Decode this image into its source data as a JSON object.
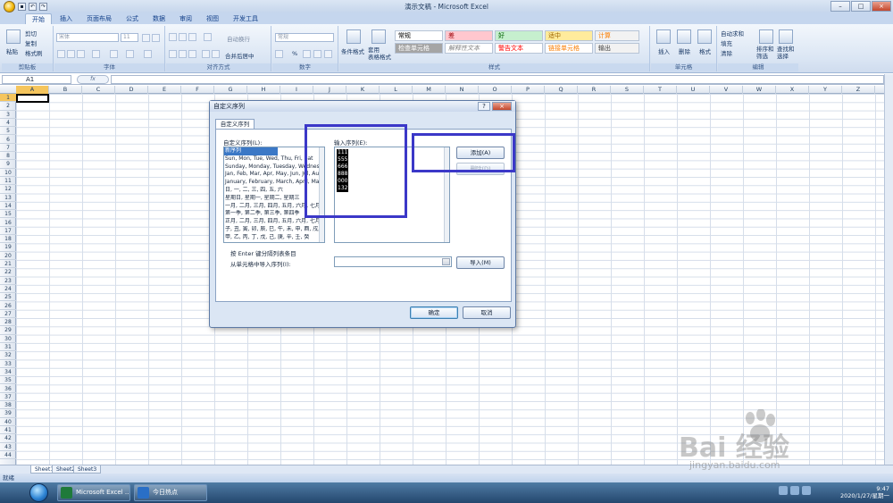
{
  "window": {
    "title": "演示文稿 - Microsoft Excel",
    "controls": [
      "–",
      "□",
      "×"
    ]
  },
  "tabs": [
    "开始",
    "插入",
    "页面布局",
    "公式",
    "数据",
    "审阅",
    "视图",
    "开发工具"
  ],
  "ribbon": {
    "clipboard": {
      "label": "剪贴板",
      "paste": "粘贴",
      "cut": "剪切",
      "copy": "复制",
      "format_painter": "格式刷"
    },
    "font": {
      "label": "字体",
      "font_name": "宋体",
      "font_size": "11"
    },
    "alignment": {
      "label": "对齐方式",
      "wrap": "自动换行",
      "merge": "合并后居中"
    },
    "number": {
      "label": "数字",
      "format": "常规",
      "percent": "%"
    },
    "styles": {
      "label": "样式",
      "conditional": "条件格式",
      "table_format": "套用\n表格格式",
      "cells": [
        {
          "text": "常规",
          "bg": "#ffffff",
          "fg": "#000000"
        },
        {
          "text": "差",
          "bg": "#ffc7ce",
          "fg": "#9c0006"
        },
        {
          "text": "好",
          "bg": "#c6efce",
          "fg": "#006100"
        },
        {
          "text": "适中",
          "bg": "#ffeb9c",
          "fg": "#9c6500"
        },
        {
          "text": "计算",
          "bg": "#f2f2f2",
          "fg": "#fa7d00"
        },
        {
          "text": "检查单元格",
          "bg": "#a5a5a5",
          "fg": "#ffffff"
        },
        {
          "text": "解释性文本",
          "bg": "#ffffff",
          "fg": "#7f7f7f"
        },
        {
          "text": "警告文本",
          "bg": "#ffffff",
          "fg": "#ff0000"
        },
        {
          "text": "链接单元格",
          "bg": "#ffffff",
          "fg": "#fa7d00"
        },
        {
          "text": "输出",
          "bg": "#f2f2f2",
          "fg": "#3f3f3f"
        }
      ]
    },
    "cells_group": {
      "label": "单元格",
      "insert": "插入",
      "delete": "删除",
      "format": "格式"
    },
    "editing": {
      "label": "编辑",
      "autosum": "自动求和",
      "fill": "填充",
      "clear": "清除",
      "sort": "排序和\n筛选",
      "find": "查找和\n选择"
    }
  },
  "formula_bar": {
    "cell_ref": "A1",
    "fx": "fx"
  },
  "columns": [
    "A",
    "B",
    "C",
    "D",
    "E",
    "F",
    "G",
    "H",
    "I",
    "J",
    "K",
    "L",
    "M",
    "N",
    "O",
    "P",
    "Q",
    "R",
    "S",
    "T",
    "U",
    "V",
    "W",
    "X",
    "Y",
    "Z"
  ],
  "rows": [
    "1",
    "2",
    "3",
    "4",
    "5",
    "6",
    "7",
    "8",
    "9",
    "10",
    "11",
    "12",
    "13",
    "14",
    "15",
    "16",
    "17",
    "18",
    "19",
    "20",
    "21",
    "22",
    "23",
    "24",
    "25",
    "26",
    "27",
    "28",
    "29",
    "30",
    "31",
    "32",
    "33",
    "34",
    "35",
    "36",
    "37",
    "38",
    "39",
    "40",
    "41",
    "42",
    "43",
    "44"
  ],
  "sheets": [
    "Sheet1",
    "Sheet2",
    "Sheet3"
  ],
  "status": "就绪",
  "dialog": {
    "title": "自定义序列",
    "help": "?",
    "close": "×",
    "tab": "自定义序列",
    "list_label": "自定义序列(L):",
    "entries_label": "输入序列(E):",
    "lists": [
      "新序列",
      "Sun, Mon, Tue, Wed, Thu, Fri, Sat",
      "Sunday, Monday, Tuesday, Wednes",
      "Jan, Feb, Mar, Apr, May, Jun, Jul, Au",
      "January, February, March, April, Ma",
      "日, 一, 二, 三, 四, 五, 六",
      "星期日, 星期一, 星期二, 星期三",
      "一月, 二月, 三月, 四月, 五月, 六月, 七月",
      "第一季, 第二季, 第三季, 第四季",
      "正月, 二月, 三月, 四月, 五月, 六月, 七月",
      "子, 丑, 寅, 卯, 辰, 巳, 午, 未, 申, 酉, 戌,",
      "甲, 乙, 丙, 丁, 戊, 己, 庚, 辛, 壬, 癸"
    ],
    "entries": [
      "111",
      "555",
      "666",
      "888",
      "000",
      "132"
    ],
    "add_button": "添加(A)",
    "delete_button": "删除(D)",
    "hint": "按 Enter 键分隔列表条目",
    "import_label": "从单元格中导入序列(I):",
    "import_button": "导入(M)",
    "ok": "确定",
    "cancel": "取消"
  },
  "taskbar": {
    "excel_task": "Microsoft Excel ...",
    "news_task": "今日热点",
    "time": "9:47",
    "date": "2020/1/27/星期一"
  },
  "watermark": {
    "brand": "Bai 经验",
    "url": "jingyan.baidu.com"
  }
}
